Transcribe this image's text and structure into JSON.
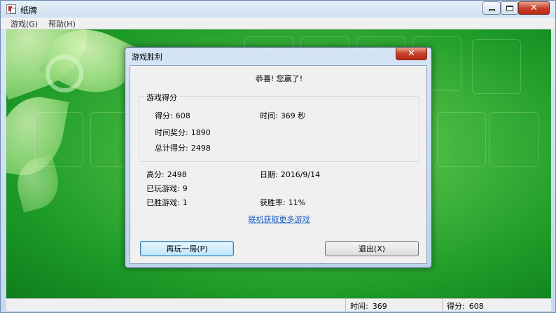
{
  "window": {
    "title": "纸牌"
  },
  "menu": {
    "game": "游戏(G)",
    "help": "帮助(H)"
  },
  "status": {
    "time_label": "时间:",
    "time_value": "369",
    "score_label": "得分:",
    "score_value": "608"
  },
  "dialog": {
    "title": "游戏胜利",
    "congrats": "恭喜! 您赢了!",
    "score_group": {
      "label": "游戏得分",
      "score_label": "得分:",
      "score_value": "608",
      "time_label": "时间:",
      "time_value": "369 秒",
      "bonus_label": "时间奖分:",
      "bonus_value": "1890",
      "total_label": "总计得分:",
      "total_value": "2498"
    },
    "stats": {
      "high_label": "高分:",
      "high_value": "2498",
      "date_label": "日期:",
      "date_value": "2016/9/14",
      "played_label": "已玩游戏:",
      "played_value": "9",
      "won_label": "已胜游戏:",
      "won_value": "1",
      "rate_label": "获胜率:",
      "rate_value": "11%"
    },
    "link": "联机获取更多游戏",
    "play_again": "再玩一局(P)",
    "exit": "退出(X)"
  }
}
